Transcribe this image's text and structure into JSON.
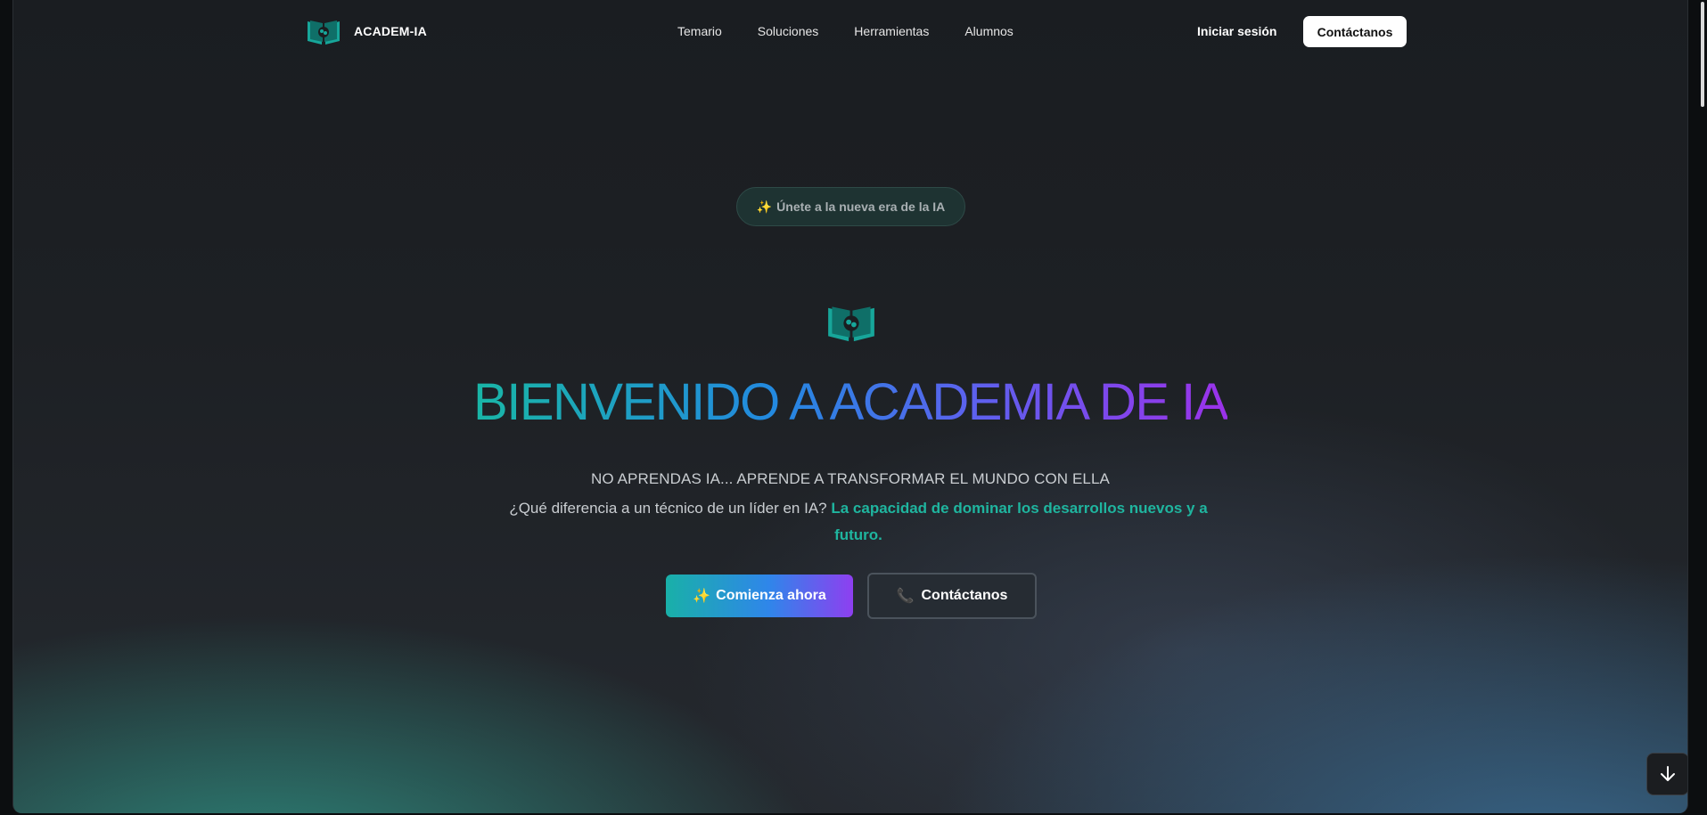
{
  "header": {
    "brand": "ACADEM-IA",
    "nav": [
      "Temario",
      "Soluciones",
      "Herramientas",
      "Alumnos"
    ],
    "login": "Iniciar sesión",
    "contact": "Contáctanos"
  },
  "hero": {
    "pill_icon": "sparkles-icon",
    "pill_emoji": "✨",
    "pill_text": "Únete a la nueva era de la IA",
    "title": "BIENVENIDO A ACADEMIA DE IA",
    "subtitle": "NO APRENDAS IA... APRENDE A TRANSFORMAR EL MUNDO CON ELLA",
    "question": "¿Qué diferencia a un técnico de un líder en IA?",
    "answer": "La capacidad de dominar los desarrollos nuevos y a futuro.",
    "primary_emoji": "✨",
    "primary_button": "Comienza ahora",
    "secondary_emoji": "📞",
    "secondary_button": "Contáctanos"
  },
  "colors": {
    "accent_teal": "#1fb59f",
    "accent_blue": "#2389e0",
    "accent_purple": "#9b32ea",
    "logo_teal": "#17a69a"
  }
}
